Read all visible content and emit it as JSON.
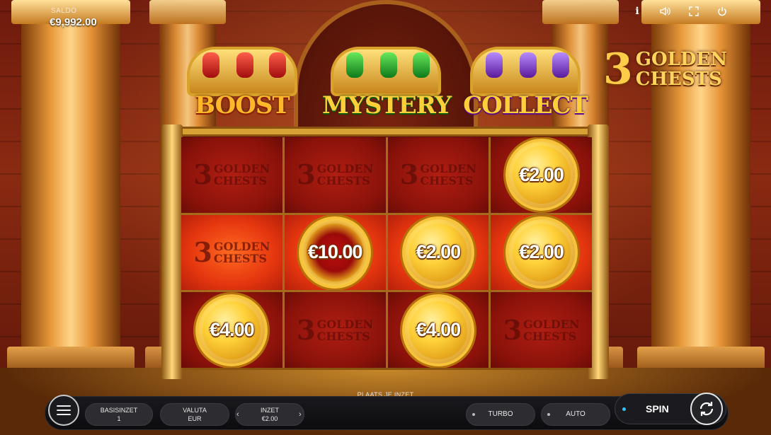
{
  "header": {
    "balance_label": "SALDO",
    "balance_value": "€9,992.00",
    "icons": [
      "info-icon",
      "sound-icon",
      "fullscreen-icon",
      "power-icon"
    ],
    "info_glyph": "i"
  },
  "logo": {
    "number": "3",
    "line1": "GOLDEN",
    "line2": "CHESTS"
  },
  "chests": [
    {
      "label": "BOOST",
      "color": "#d11a12"
    },
    {
      "label": "MYSTERY",
      "color": "#1f9a2a"
    },
    {
      "label": "COLLECT",
      "color": "#7a2ad1"
    }
  ],
  "grid": {
    "cell_logo": {
      "number": "3",
      "line1": "GOLDEN",
      "line2": "CHESTS"
    },
    "rows": [
      [
        {
          "type": "logo"
        },
        {
          "type": "logo"
        },
        {
          "type": "logo"
        },
        {
          "type": "coin",
          "value": "€2.00"
        }
      ],
      [
        {
          "type": "logo"
        },
        {
          "type": "coin",
          "value": "€10.00"
        },
        {
          "type": "coin",
          "value": "€2.00"
        },
        {
          "type": "coin",
          "value": "€2.00"
        }
      ],
      [
        {
          "type": "coin",
          "value": "€4.00"
        },
        {
          "type": "logo"
        },
        {
          "type": "coin",
          "value": "€4.00"
        },
        {
          "type": "logo"
        }
      ]
    ]
  },
  "controls": {
    "hint": "PLAATS JE INZET",
    "basisinzet_label": "BASISINZET",
    "basisinzet_value": "1",
    "valuta_label": "VALUTA",
    "valuta_value": "EUR",
    "inzet_label": "INZET",
    "inzet_value": "€2.00",
    "turbo_label": "TURBO",
    "auto_label": "AUTO",
    "spin_label": "SPIN",
    "arrow_left": "‹",
    "arrow_right": "›"
  },
  "colors": {
    "accent_gold": "#d8a133",
    "highlight_row": "#e5360f",
    "spin_indicator": "#2dc4ff"
  }
}
